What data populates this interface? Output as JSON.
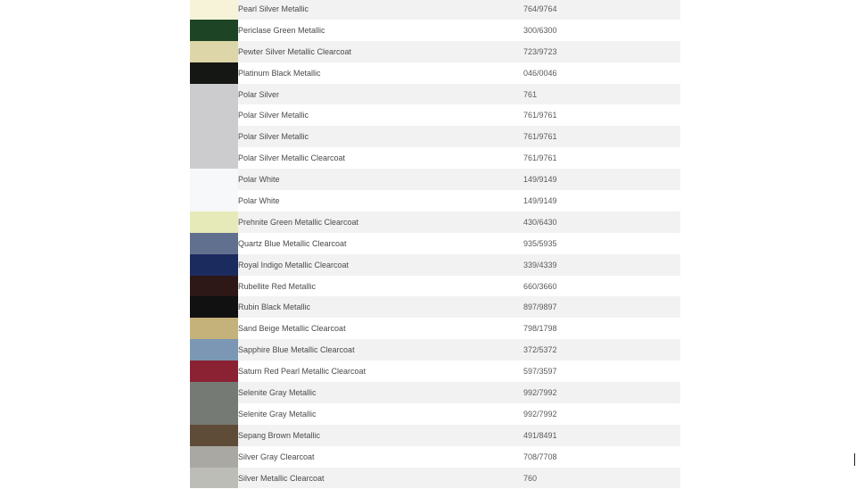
{
  "colors": [
    {
      "name": "Pearl Silver Metallic",
      "code": "764/9764",
      "swatch": "#f6f3d8"
    },
    {
      "name": "Periclase Green Metallic",
      "code": "300/6300",
      "swatch": "#1d4424"
    },
    {
      "name": "Pewter Silver Metallic Clearcoat",
      "code": "723/9723",
      "swatch": "#ddd6a8"
    },
    {
      "name": "Platinum Black Metallic",
      "code": "046/0046",
      "swatch": "#141714"
    },
    {
      "name": "Polar Silver",
      "code": "761",
      "swatch": "#ccccce"
    },
    {
      "name": "Polar Silver Metallic",
      "code": "761/9761",
      "swatch": "#ccccce"
    },
    {
      "name": "Polar Silver Metallic",
      "code": "761/9761",
      "swatch": "#ccccce"
    },
    {
      "name": "Polar Silver Metallic Clearcoat",
      "code": "761/9761",
      "swatch": "#ccccce"
    },
    {
      "name": "Polar White",
      "code": "149/9149",
      "swatch": "#f7f8fa"
    },
    {
      "name": "Polar White",
      "code": "149/9149",
      "swatch": "#f7f8fa"
    },
    {
      "name": "Prehnite Green Metallic Clearcoat",
      "code": "430/6430",
      "swatch": "#e6eab8"
    },
    {
      "name": "Quartz Blue Metallic Clearcoat",
      "code": "935/5935",
      "swatch": "#62708f"
    },
    {
      "name": "Royal Indigo Metallic Clearcoat",
      "code": "339/4339",
      "swatch": "#1c2b5e"
    },
    {
      "name": "Rubellite Red Metallic",
      "code": "660/3660",
      "swatch": "#2e1717"
    },
    {
      "name": "Rubin Black Metallic",
      "code": "897/9897",
      "swatch": "#111111"
    },
    {
      "name": "Sand Beige Metallic Clearcoat",
      "code": "798/1798",
      "swatch": "#c5b17a"
    },
    {
      "name": "Sapphire Blue Metallic Clearcoat",
      "code": "372/5372",
      "swatch": "#7b97b4"
    },
    {
      "name": "Saturn Red Pearl Metallic Clearcoat",
      "code": "597/3597",
      "swatch": "#8a2233"
    },
    {
      "name": "Selenite Gray Metallic",
      "code": "992/7992",
      "swatch": "#757a75"
    },
    {
      "name": "Selenite Gray Metallic",
      "code": "992/7992",
      "swatch": "#757a75"
    },
    {
      "name": "Sepang Brown Metallic",
      "code": "491/8491",
      "swatch": "#5e4c38"
    },
    {
      "name": "Silver Gray Clearcoat",
      "code": "708/7708",
      "swatch": "#a9a8a2"
    },
    {
      "name": "Silver Metallic Clearcoat",
      "code": "760",
      "swatch": "#bdbdb8"
    }
  ]
}
